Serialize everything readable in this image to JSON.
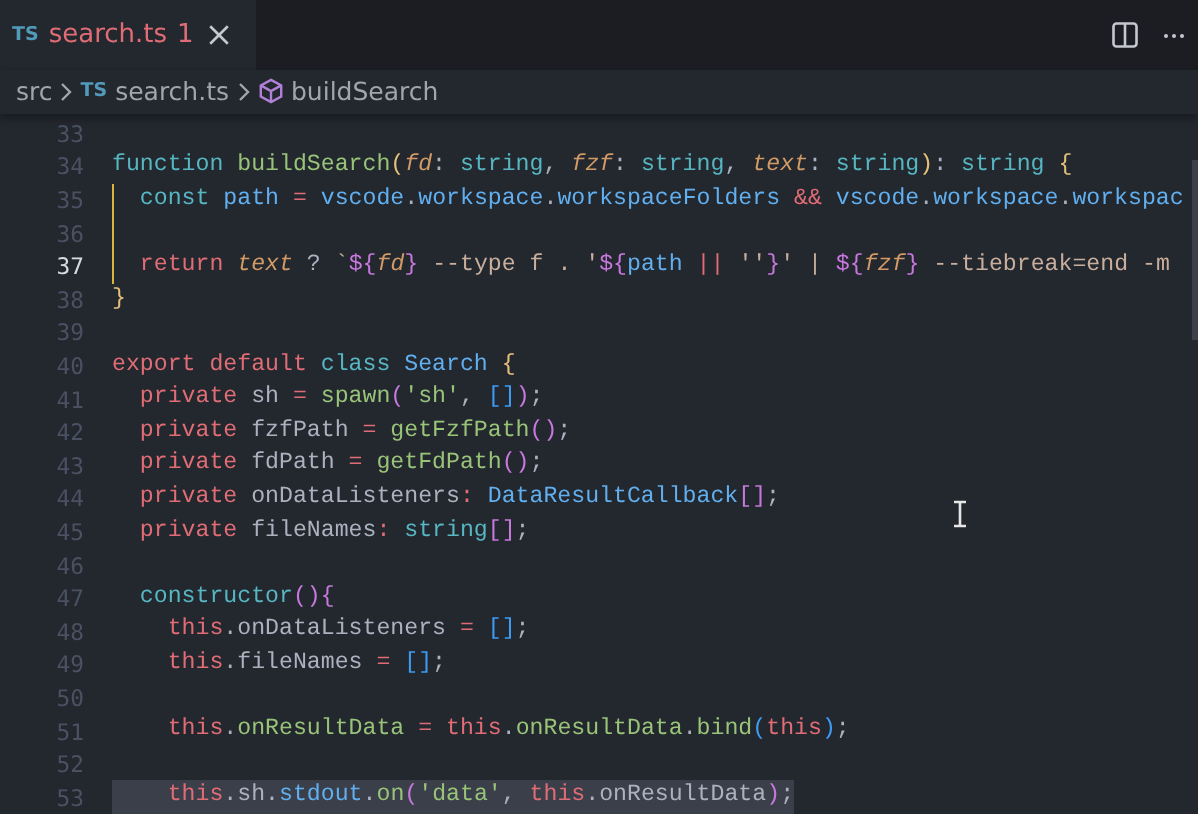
{
  "tabs": [
    {
      "icon_text": "TS",
      "label": "search.ts",
      "problem_count": "1",
      "selected": true
    }
  ],
  "breadcrumbs": [
    {
      "kind": "folder",
      "text": "src"
    },
    {
      "kind": "file",
      "icon_text": "TS",
      "text": "search.ts"
    },
    {
      "kind": "symbol",
      "text": "buildSearch"
    }
  ],
  "editor": {
    "lines": [
      {
        "number": "33",
        "current": false,
        "selected": false,
        "boxed": false
      },
      {
        "number": "34",
        "current": false,
        "selected": false,
        "boxed": false,
        "tokens": [
          {
            "kind": "kw",
            "text": "function "
          },
          {
            "kind": "fn",
            "text": "buildSearch"
          },
          {
            "kind": "brace",
            "text": "("
          },
          {
            "kind": "param",
            "text": "fd"
          },
          {
            "kind": "plain",
            "text": ": "
          },
          {
            "kind": "type",
            "text": "string"
          },
          {
            "kind": "plain",
            "text": ", "
          },
          {
            "kind": "param",
            "text": "fzf"
          },
          {
            "kind": "plain",
            "text": ": "
          },
          {
            "kind": "type",
            "text": "string"
          },
          {
            "kind": "plain",
            "text": ", "
          },
          {
            "kind": "param",
            "text": "text"
          },
          {
            "kind": "plain",
            "text": ": "
          },
          {
            "kind": "type",
            "text": "string"
          },
          {
            "kind": "brace",
            "text": ")"
          },
          {
            "kind": "plain",
            "text": ": "
          },
          {
            "kind": "type",
            "text": "string "
          },
          {
            "kind": "brace",
            "text": "{"
          }
        ]
      },
      {
        "number": "35",
        "current": false,
        "selected": false,
        "boxed": true,
        "tokens": [
          {
            "kind": "kw",
            "text": "  const "
          },
          {
            "kind": "var",
            "text": "path"
          },
          {
            "kind": "op",
            "text": " = "
          },
          {
            "kind": "var",
            "text": "vscode"
          },
          {
            "kind": "plain",
            "text": "."
          },
          {
            "kind": "var",
            "text": "workspace"
          },
          {
            "kind": "plain",
            "text": "."
          },
          {
            "kind": "var",
            "text": "workspaceFolders"
          },
          {
            "kind": "op",
            "text": " && "
          },
          {
            "kind": "var",
            "text": "vscode"
          },
          {
            "kind": "plain",
            "text": "."
          },
          {
            "kind": "var",
            "text": "workspace"
          },
          {
            "kind": "plain",
            "text": "."
          },
          {
            "kind": "var",
            "text": "workspac"
          }
        ]
      },
      {
        "number": "36",
        "current": false,
        "selected": false,
        "boxed": true
      },
      {
        "number": "37",
        "current": true,
        "selected": false,
        "boxed": true,
        "tokens": [
          {
            "kind": "kw2",
            "text": "  return "
          },
          {
            "kind": "param",
            "text": "text"
          },
          {
            "kind": "plain",
            "text": " ? "
          },
          {
            "kind": "tpl",
            "text": "`"
          },
          {
            "kind": "bracket",
            "text": "${"
          },
          {
            "kind": "param",
            "text": "fd"
          },
          {
            "kind": "bracket",
            "text": "}"
          },
          {
            "kind": "tpl",
            "text": " --type f . '"
          },
          {
            "kind": "bracket",
            "text": "${"
          },
          {
            "kind": "var",
            "text": "path"
          },
          {
            "kind": "op",
            "text": " || "
          },
          {
            "kind": "tpl",
            "text": "''"
          },
          {
            "kind": "bracket",
            "text": "}"
          },
          {
            "kind": "tpl",
            "text": "' | "
          },
          {
            "kind": "bracket",
            "text": "${"
          },
          {
            "kind": "param",
            "text": "fzf"
          },
          {
            "kind": "bracket",
            "text": "}"
          },
          {
            "kind": "tpl",
            "text": " --tiebreak=end -m"
          }
        ]
      },
      {
        "number": "38",
        "current": false,
        "selected": false,
        "boxed": false,
        "tokens": [
          {
            "kind": "brace",
            "text": "}"
          }
        ]
      },
      {
        "number": "39",
        "current": false,
        "selected": false,
        "boxed": false
      },
      {
        "number": "40",
        "current": false,
        "selected": false,
        "boxed": false,
        "tokens": [
          {
            "kind": "kw2",
            "text": "export default "
          },
          {
            "kind": "kw",
            "text": "class "
          },
          {
            "kind": "var",
            "text": "Search "
          },
          {
            "kind": "brace",
            "text": "{"
          }
        ]
      },
      {
        "number": "41",
        "current": false,
        "selected": false,
        "boxed": false,
        "tokens": [
          {
            "kind": "kw2",
            "text": "  private"
          },
          {
            "kind": "plain",
            "text": " sh"
          },
          {
            "kind": "op",
            "text": " = "
          },
          {
            "kind": "fn",
            "text": "spawn"
          },
          {
            "kind": "bracket",
            "text": "("
          },
          {
            "kind": "str",
            "text": "'sh'"
          },
          {
            "kind": "plain",
            "text": ", "
          },
          {
            "kind": "bracket2",
            "text": "[]"
          },
          {
            "kind": "bracket",
            "text": ")"
          },
          {
            "kind": "plain",
            "text": ";"
          }
        ]
      },
      {
        "number": "42",
        "current": false,
        "selected": false,
        "boxed": false,
        "tokens": [
          {
            "kind": "kw2",
            "text": "  private"
          },
          {
            "kind": "plain",
            "text": " fzfPath"
          },
          {
            "kind": "op",
            "text": " = "
          },
          {
            "kind": "fn",
            "text": "getFzfPath"
          },
          {
            "kind": "bracket",
            "text": "()"
          },
          {
            "kind": "plain",
            "text": ";"
          }
        ]
      },
      {
        "number": "43",
        "current": false,
        "selected": false,
        "boxed": false,
        "tokens": [
          {
            "kind": "kw2",
            "text": "  private"
          },
          {
            "kind": "plain",
            "text": " fdPath"
          },
          {
            "kind": "op",
            "text": " = "
          },
          {
            "kind": "fn",
            "text": "getFdPath"
          },
          {
            "kind": "bracket",
            "text": "()"
          },
          {
            "kind": "plain",
            "text": ";"
          }
        ]
      },
      {
        "number": "44",
        "current": false,
        "selected": false,
        "boxed": false,
        "tokens": [
          {
            "kind": "kw2",
            "text": "  private"
          },
          {
            "kind": "plain",
            "text": " onDataListeners"
          },
          {
            "kind": "op",
            "text": ": "
          },
          {
            "kind": "var",
            "text": "DataResultCallback"
          },
          {
            "kind": "bracket",
            "text": "[]"
          },
          {
            "kind": "plain",
            "text": ";"
          }
        ]
      },
      {
        "number": "45",
        "current": false,
        "selected": false,
        "boxed": false,
        "tokens": [
          {
            "kind": "kw2",
            "text": "  private"
          },
          {
            "kind": "plain",
            "text": " fileNames"
          },
          {
            "kind": "op",
            "text": ": "
          },
          {
            "kind": "type",
            "text": "string"
          },
          {
            "kind": "bracket",
            "text": "[]"
          },
          {
            "kind": "plain",
            "text": ";"
          }
        ]
      },
      {
        "number": "46",
        "current": false,
        "selected": false,
        "boxed": false
      },
      {
        "number": "47",
        "current": false,
        "selected": false,
        "boxed": false,
        "tokens": [
          {
            "kind": "kw",
            "text": "  constructor"
          },
          {
            "kind": "bracket",
            "text": "(){"
          }
        ]
      },
      {
        "number": "48",
        "current": false,
        "selected": false,
        "boxed": false,
        "tokens": [
          {
            "kind": "kw2",
            "text": "    this"
          },
          {
            "kind": "plain",
            "text": ".onDataListeners"
          },
          {
            "kind": "op",
            "text": " = "
          },
          {
            "kind": "bracket2",
            "text": "[]"
          },
          {
            "kind": "plain",
            "text": ";"
          }
        ]
      },
      {
        "number": "49",
        "current": false,
        "selected": false,
        "boxed": false,
        "tokens": [
          {
            "kind": "kw2",
            "text": "    this"
          },
          {
            "kind": "plain",
            "text": ".fileNames"
          },
          {
            "kind": "op",
            "text": " = "
          },
          {
            "kind": "bracket2",
            "text": "[]"
          },
          {
            "kind": "plain",
            "text": ";"
          }
        ]
      },
      {
        "number": "50",
        "current": false,
        "selected": false,
        "boxed": false
      },
      {
        "number": "51",
        "current": false,
        "selected": false,
        "boxed": false,
        "tokens": [
          {
            "kind": "kw2",
            "text": "    this"
          },
          {
            "kind": "plain",
            "text": "."
          },
          {
            "kind": "fn",
            "text": "onResultData"
          },
          {
            "kind": "op",
            "text": " = "
          },
          {
            "kind": "kw2",
            "text": "this"
          },
          {
            "kind": "plain",
            "text": "."
          },
          {
            "kind": "fn",
            "text": "onResultData"
          },
          {
            "kind": "plain",
            "text": "."
          },
          {
            "kind": "fn",
            "text": "bind"
          },
          {
            "kind": "bracket2",
            "text": "("
          },
          {
            "kind": "kw2",
            "text": "this"
          },
          {
            "kind": "bracket2",
            "text": ")"
          },
          {
            "kind": "plain",
            "text": ";"
          }
        ]
      },
      {
        "number": "52",
        "current": false,
        "selected": false,
        "boxed": false
      },
      {
        "number": "53",
        "current": false,
        "selected": true,
        "boxed": false,
        "tokens": [
          {
            "kind": "kw2",
            "text": "    this"
          },
          {
            "kind": "plain",
            "text": ".sh."
          },
          {
            "kind": "var",
            "text": "stdout"
          },
          {
            "kind": "plain",
            "text": "."
          },
          {
            "kind": "fn",
            "text": "on"
          },
          {
            "kind": "bracket",
            "text": "("
          },
          {
            "kind": "str",
            "text": "'data'"
          },
          {
            "kind": "plain",
            "text": ", "
          },
          {
            "kind": "kw2",
            "text": "this"
          },
          {
            "kind": "plain",
            "text": ".onResultData"
          },
          {
            "kind": "bracket",
            "text": ")"
          },
          {
            "kind": "plain",
            "text": ";"
          }
        ]
      }
    ]
  }
}
